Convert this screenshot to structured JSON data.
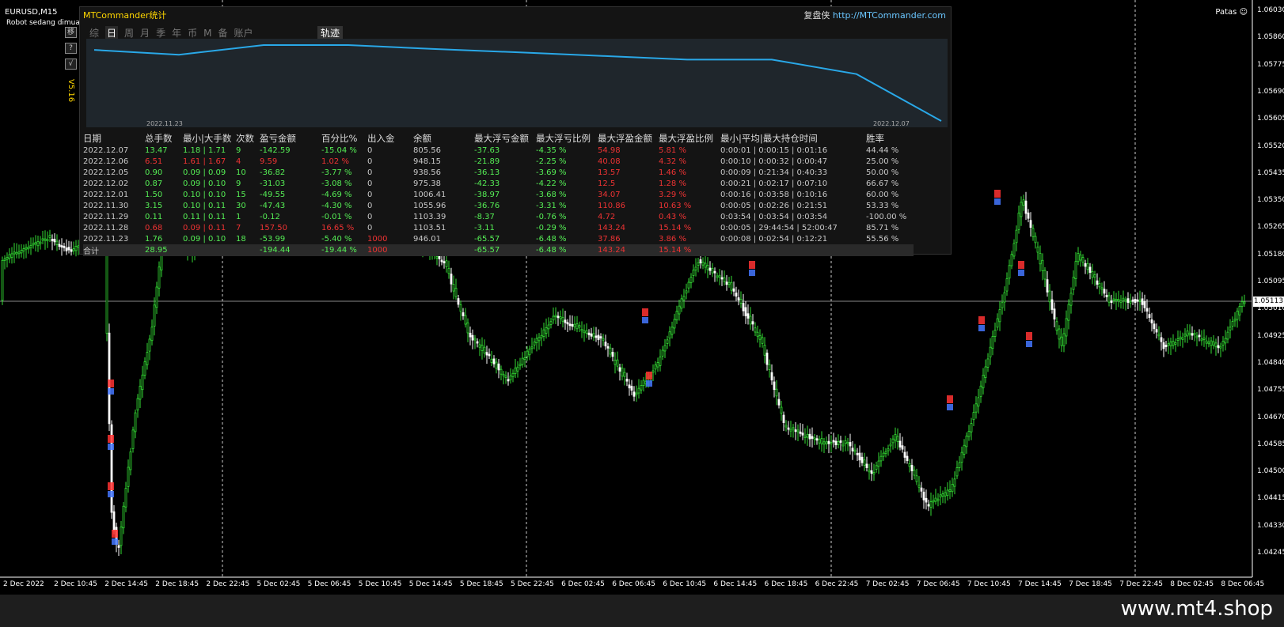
{
  "chart": {
    "symbol": "EURUSD,M15",
    "robot_status": "Robot sedang dimuat...",
    "account_label": "Patas",
    "current_price": "1.05113",
    "price_ticks": [
      "1.06030",
      "1.05860",
      "1.05775",
      "1.05690",
      "1.05605",
      "1.05520",
      "1.05435",
      "1.05350",
      "1.05265",
      "1.05180",
      "1.05095",
      "1.05010",
      "1.04925",
      "1.04840",
      "1.04755",
      "1.04670",
      "1.04585",
      "1.04500",
      "1.04415",
      "1.04330",
      "1.04245"
    ],
    "time_ticks": [
      "2 Dec 2022",
      "2 Dec 10:45",
      "2 Dec 14:45",
      "2 Dec 18:45",
      "2 Dec 22:45",
      "5 Dec 02:45",
      "5 Dec 06:45",
      "5 Dec 10:45",
      "5 Dec 14:45",
      "5 Dec 18:45",
      "5 Dec 22:45",
      "6 Dec 02:45",
      "6 Dec 06:45",
      "6 Dec 10:45",
      "6 Dec 14:45",
      "6 Dec 18:45",
      "6 Dec 22:45",
      "7 Dec 02:45",
      "7 Dec 06:45",
      "7 Dec 10:45",
      "7 Dec 14:45",
      "7 Dec 18:45",
      "7 Dec 22:45",
      "8 Dec 02:45",
      "8 Dec 06:45"
    ],
    "bull_color": "#33dd33",
    "bear_color": "#ffffff"
  },
  "watermark": "www.mt4.shop",
  "panel": {
    "title": "MTCommander统计",
    "link_prefix": "复盘侠",
    "link_url": "http://MTCommander.com",
    "version": "V5.16",
    "tabs": [
      "综",
      "日",
      "周",
      "月",
      "季",
      "年",
      "币",
      "M",
      "备",
      "账户"
    ],
    "active_tab": "日",
    "track_label": "轨迹",
    "side_buttons": [
      "移",
      "?",
      "√"
    ],
    "graph_start_date": "2022.11.23",
    "graph_end_date": "2022.12.07",
    "headers": [
      "日期",
      "总手数",
      "最小|大手数",
      "次数",
      "盈亏金额",
      "百分比%",
      "出入金",
      "余额",
      "最大浮亏金额",
      "最大浮亏比例",
      "最大浮盈金额",
      "最大浮盈比例",
      "最小|平均|最大持仓时间",
      "胜率"
    ],
    "rows": [
      [
        "2022.12.07",
        "13.47",
        "1.18 | 1.71",
        "9",
        "-142.59",
        "-15.04 %",
        "0",
        "805.56",
        "-37.63",
        "-4.35 %",
        "54.98",
        "5.81 %",
        "0:00:01 | 0:00:15 | 0:01:16",
        "44.44 %"
      ],
      [
        "2022.12.06",
        "6.51",
        "1.61 | 1.67",
        "4",
        "9.59",
        "1.02 %",
        "0",
        "948.15",
        "-21.89",
        "-2.25 %",
        "40.08",
        "4.32 %",
        "0:00:10 | 0:00:32 | 0:00:47",
        "25.00 %"
      ],
      [
        "2022.12.05",
        "0.90",
        "0.09 | 0.09",
        "10",
        "-36.82",
        "-3.77 %",
        "0",
        "938.56",
        "-36.13",
        "-3.69 %",
        "13.57",
        "1.46 %",
        "0:00:09 | 0:21:34 | 0:40:33",
        "50.00 %"
      ],
      [
        "2022.12.02",
        "0.87",
        "0.09 | 0.10",
        "9",
        "-31.03",
        "-3.08 %",
        "0",
        "975.38",
        "-42.33",
        "-4.22 %",
        "12.5",
        "1.28 %",
        "0:00:21 | 0:02:17 | 0:07:10",
        "66.67 %"
      ],
      [
        "2022.12.01",
        "1.50",
        "0.10 | 0.10",
        "15",
        "-49.55",
        "-4.69 %",
        "0",
        "1006.41",
        "-38.97",
        "-3.68 %",
        "34.07",
        "3.29 %",
        "0:00:16 | 0:03:58 | 0:10:16",
        "60.00 %"
      ],
      [
        "2022.11.30",
        "3.15",
        "0.10 | 0.11",
        "30",
        "-47.43",
        "-4.30 %",
        "0",
        "1055.96",
        "-36.76",
        "-3.31 %",
        "110.86",
        "10.63 %",
        "0:00:05 | 0:02:26 | 0:21:51",
        "53.33 %"
      ],
      [
        "2022.11.29",
        "0.11",
        "0.11 | 0.11",
        "1",
        "-0.12",
        "-0.01 %",
        "0",
        "1103.39",
        "-8.37",
        "-0.76 %",
        "4.72",
        "0.43 %",
        "0:03:54 | 0:03:54 | 0:03:54",
        "-100.00 %"
      ],
      [
        "2022.11.28",
        "0.68",
        "0.09 | 0.11",
        "7",
        "157.50",
        "16.65 %",
        "0",
        "1103.51",
        "-3.11",
        "-0.29 %",
        "143.24",
        "15.14 %",
        "0:00:05 | 29:44:54 | 52:00:47",
        "85.71 %"
      ],
      [
        "2022.11.23",
        "1.76",
        "0.09 | 0.10",
        "18",
        "-53.99",
        "-5.40 %",
        "1000",
        "946.01",
        "-65.57",
        "-6.48 %",
        "37.86",
        "3.86 %",
        "0:00:08 | 0:02:54 | 0:12:21",
        "55.56 %"
      ]
    ],
    "total": [
      "合计",
      "28.95",
      "",
      "",
      "-194.44",
      "-19.44 %",
      "1000",
      "",
      "-65.57",
      "-6.48 %",
      "143.24",
      "15.14 %",
      "",
      ""
    ],
    "equity_curve": [
      1100,
      1080,
      1120,
      1120,
      1104,
      1090,
      1075,
      1060,
      1060,
      1000,
      806
    ]
  }
}
